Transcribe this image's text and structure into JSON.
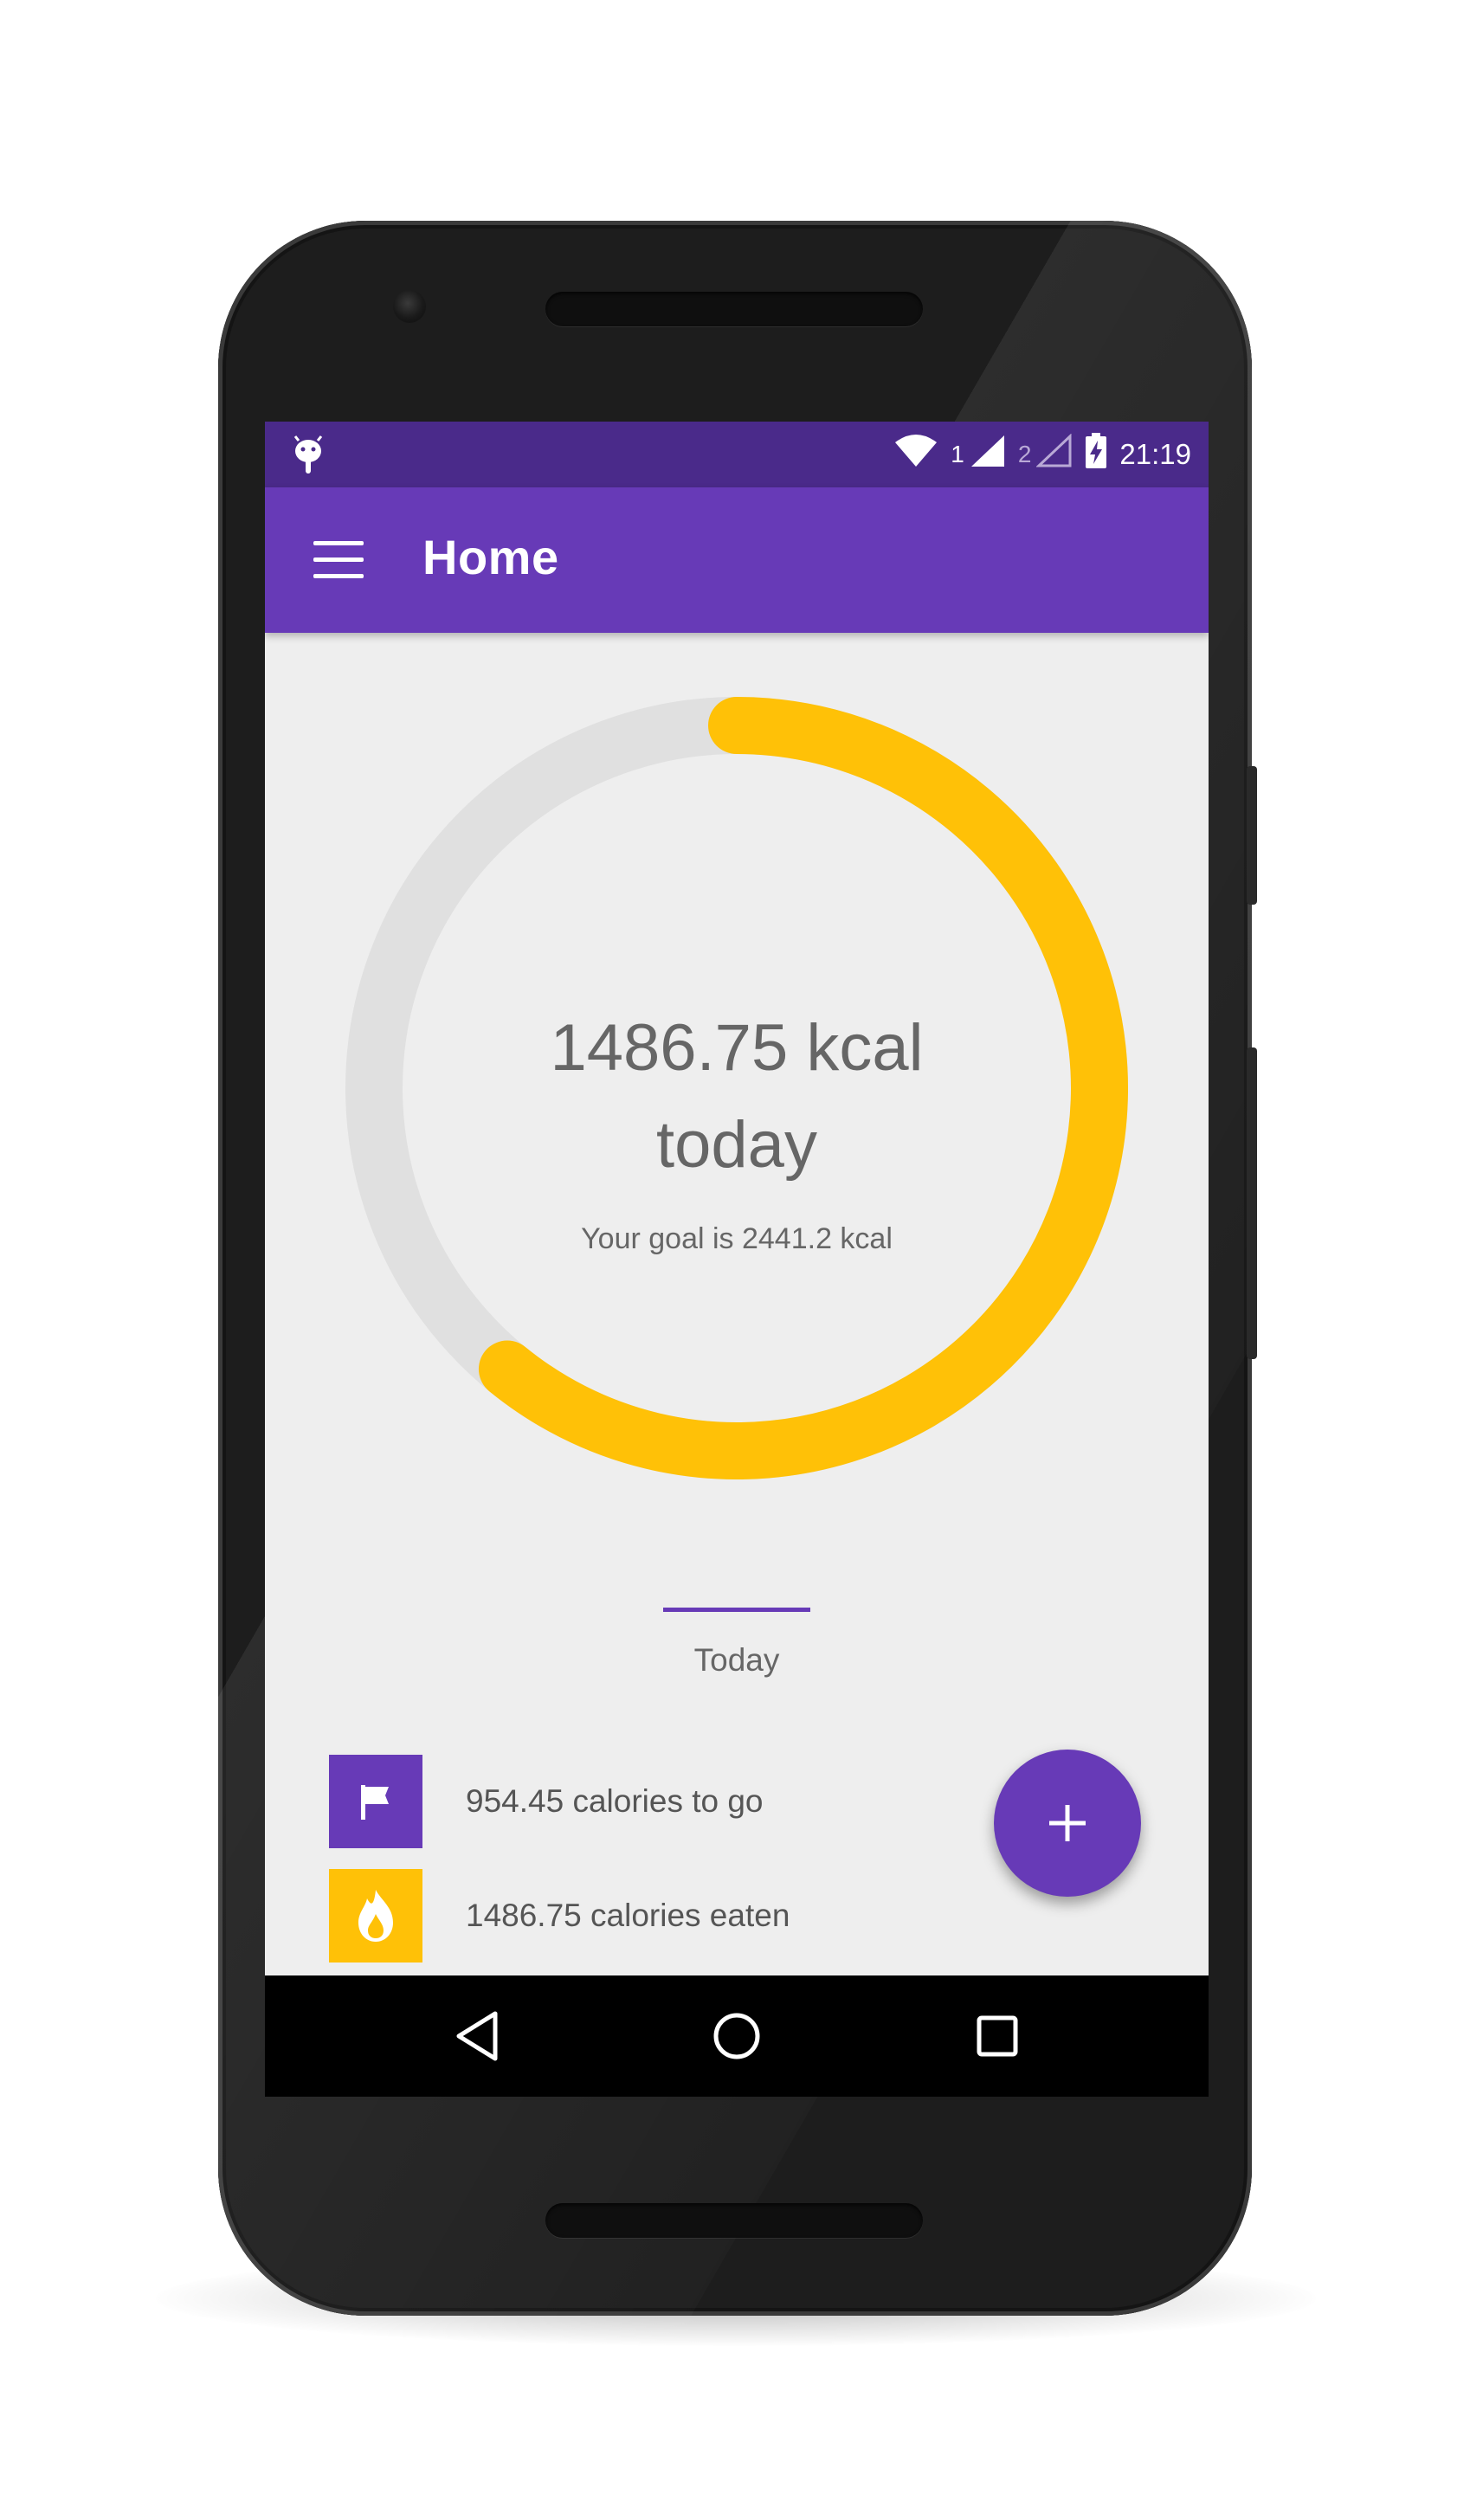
{
  "status_bar": {
    "time": "21:19",
    "sim1_label": "1",
    "sim2_label": "2",
    "icons": [
      "android-debug-icon",
      "wifi-icon",
      "signal-sim1-icon",
      "signal-sim2-icon",
      "battery-charging-icon"
    ]
  },
  "app_bar": {
    "title": "Home",
    "menu_icon": "hamburger-menu-icon"
  },
  "summary": {
    "kcal_line": "1486.75 kcal",
    "today_line": "today",
    "goal_text": "Your goal is 2441.2 kcal",
    "progress_fraction": 0.609,
    "progress_color": "#ffc107",
    "track_color": "#e0e0e0"
  },
  "tabs": {
    "active_label": "Today"
  },
  "stats": [
    {
      "text": "954.45 calories to go",
      "icon": "flag-icon",
      "color": "#673ab7"
    },
    {
      "text": "1486.75 calories eaten",
      "icon": "fire-icon",
      "color": "#ffc107"
    }
  ],
  "fab": {
    "icon": "plus-icon"
  },
  "nav_bar": {
    "icons": [
      "back-icon",
      "home-icon",
      "recents-icon"
    ]
  },
  "colors": {
    "primary": "#673ab7",
    "primary_dark": "#4a2a8a",
    "accent": "#ffc107"
  }
}
